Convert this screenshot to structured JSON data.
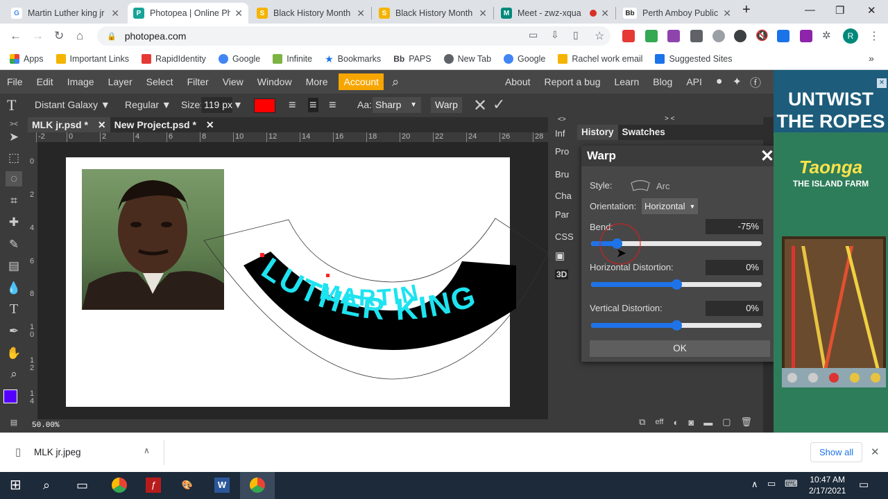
{
  "browser": {
    "tabs": [
      {
        "label": "Martin Luther king jr",
        "fav": "G",
        "favcolor": "#4285f4",
        "active": false
      },
      {
        "label": "Photopea | Online Ph",
        "fav": "P",
        "favcolor": "#18a497",
        "active": true
      },
      {
        "label": "Black History Month",
        "fav": "S",
        "favcolor": "#f4b400",
        "active": false
      },
      {
        "label": "Black History Month",
        "fav": "S",
        "favcolor": "#f4b400",
        "active": false
      },
      {
        "label": "Meet - zwz-xqua",
        "fav": "M",
        "favcolor": "#00897b",
        "active": false
      },
      {
        "label": "Perth Amboy Public",
        "fav": "Bb",
        "favcolor": "#222222",
        "active": false
      }
    ],
    "url": "photopea.com",
    "bookmarks": [
      {
        "label": "Apps",
        "color": "#4285f4"
      },
      {
        "label": "Important Links",
        "color": "#f4b400"
      },
      {
        "label": "RapidIdentity",
        "color": "#e53935"
      },
      {
        "label": "Google",
        "color": "#4285f4"
      },
      {
        "label": "Infinite",
        "color": "#7cb342"
      },
      {
        "label": "Bookmarks",
        "color": "#1a73e8"
      },
      {
        "label": "PAPS",
        "color": "#222222"
      },
      {
        "label": "New Tab",
        "color": "#5f6368"
      },
      {
        "label": "Google",
        "color": "#4285f4"
      },
      {
        "label": "Rachel work email",
        "color": "#f4b400"
      },
      {
        "label": "Suggested Sites",
        "color": "#1a73e8"
      }
    ],
    "profile_initial": "R"
  },
  "menu": {
    "items": [
      "File",
      "Edit",
      "Image",
      "Layer",
      "Select",
      "Filter",
      "View",
      "Window",
      "More"
    ],
    "account": "Account",
    "right": [
      "About",
      "Report a bug",
      "Learn",
      "Blog",
      "API"
    ]
  },
  "options": {
    "font": "Distant Galaxy ▼",
    "style": "Regular ▼",
    "size_label": "Size:",
    "size_value": "119 px",
    "color": "#ff0000",
    "aa_label": "Aa:",
    "aa_value": "Sharp",
    "warp": "Warp"
  },
  "documents": [
    {
      "name": "MLK jr.psd *",
      "active": true
    },
    {
      "name": "New Project.psd *",
      "active": false
    }
  ],
  "ruler_h": [
    "-2",
    "0",
    "2",
    "4",
    "6",
    "8",
    "10",
    "12",
    "14",
    "16",
    "18",
    "20",
    "22",
    "24",
    "26",
    "28"
  ],
  "ruler_v": [
    "0",
    "2",
    "4",
    "6",
    "8",
    "10",
    "12",
    "14"
  ],
  "canvas_text": {
    "line1": "MARTIN",
    "line2": "LUTHER KING",
    "fill": "#1ee3f0"
  },
  "zoom": "50.00%",
  "collapsed_panels": [
    "Inf",
    "Pro",
    "Bru",
    "Cha",
    "Par",
    "CSS"
  ],
  "panel_tabs": [
    "History",
    "Swatches"
  ],
  "warp_dialog": {
    "title": "Warp",
    "style_label": "Style:",
    "style_value": "Arc",
    "orientation_label": "Orientation:",
    "orientation_value": "Horizontal",
    "bend_label": "Bend:",
    "bend_value": "-75%",
    "bend_level": 0.15,
    "hdist_label": "Horizontal Distortion:",
    "hdist_value": "0%",
    "hdist_level": 0.5,
    "vdist_label": "Vertical Distortion:",
    "vdist_value": "0%",
    "vdist_level": 0.5,
    "ok": "OK"
  },
  "ad": {
    "headline1": "UNTWIST",
    "headline2": "THE ROPES",
    "brand": "Taonga",
    "brand_sub": "THE ISLAND FARM"
  },
  "download": {
    "file": "MLK jr.jpeg",
    "show_all": "Show all"
  },
  "taskbar": {
    "time": "10:47 AM",
    "date": "2/17/2021"
  }
}
